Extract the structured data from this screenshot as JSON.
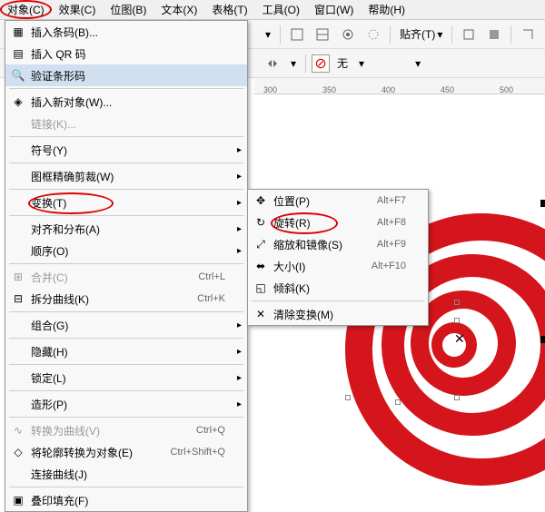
{
  "menubar": {
    "items": [
      "对象(C)",
      "效果(C)",
      "位图(B)",
      "文本(X)",
      "表格(T)",
      "工具(O)",
      "窗口(W)",
      "帮助(H)"
    ]
  },
  "toolbar": {
    "align_label": "贴齐(T)"
  },
  "fill": {
    "none_label": "无"
  },
  "ruler": {
    "marks": [
      "300",
      "350",
      "400",
      "450",
      "500"
    ]
  },
  "menu": {
    "items": [
      {
        "label": "插入条码(B)...",
        "icon": "barcode"
      },
      {
        "label": "插入 QR 码",
        "icon": "qr"
      },
      {
        "label": "验证条形码",
        "icon": "magnify",
        "hover": true
      },
      {
        "sep": true
      },
      {
        "label": "插入新对象(W)...",
        "icon": "insert"
      },
      {
        "label": "链接(K)...",
        "disabled": true
      },
      {
        "sep": true
      },
      {
        "label": "符号(Y)",
        "arrow": true
      },
      {
        "sep": true
      },
      {
        "label": "图框精确剪裁(W)",
        "arrow": true
      },
      {
        "sep": true
      },
      {
        "label": "变换(T)",
        "arrow": true,
        "highlighted": true
      },
      {
        "sep": true
      },
      {
        "label": "对齐和分布(A)",
        "arrow": true
      },
      {
        "label": "顺序(O)",
        "arrow": true
      },
      {
        "sep": true
      },
      {
        "label": "合并(C)",
        "shortcut": "Ctrl+L",
        "disabled": true,
        "icon": "merge"
      },
      {
        "label": "拆分曲线(K)",
        "shortcut": "Ctrl+K",
        "icon": "split"
      },
      {
        "sep": true
      },
      {
        "label": "组合(G)",
        "arrow": true
      },
      {
        "sep": true
      },
      {
        "label": "隐藏(H)",
        "arrow": true
      },
      {
        "sep": true
      },
      {
        "label": "锁定(L)",
        "arrow": true
      },
      {
        "sep": true
      },
      {
        "label": "造形(P)",
        "arrow": true
      },
      {
        "sep": true
      },
      {
        "label": "转换为曲线(V)",
        "shortcut": "Ctrl+Q",
        "disabled": true,
        "icon": "curve"
      },
      {
        "label": "将轮廓转换为对象(E)",
        "shortcut": "Ctrl+Shift+Q",
        "icon": "outline"
      },
      {
        "label": "连接曲线(J)"
      },
      {
        "sep": true
      },
      {
        "label": "叠印填充(F)",
        "icon": "overprint"
      }
    ]
  },
  "submenu": {
    "items": [
      {
        "label": "位置(P)",
        "shortcut": "Alt+F7",
        "icon": "position"
      },
      {
        "label": "旋转(R)",
        "shortcut": "Alt+F8",
        "icon": "rotate",
        "highlighted": true
      },
      {
        "label": "缩放和镜像(S)",
        "shortcut": "Alt+F9",
        "icon": "scale"
      },
      {
        "label": "大小(I)",
        "shortcut": "Alt+F10",
        "icon": "size"
      },
      {
        "label": "倾斜(K)",
        "icon": "skew"
      },
      {
        "sep": true
      },
      {
        "label": "清除变换(M)",
        "icon": "clear"
      }
    ]
  }
}
